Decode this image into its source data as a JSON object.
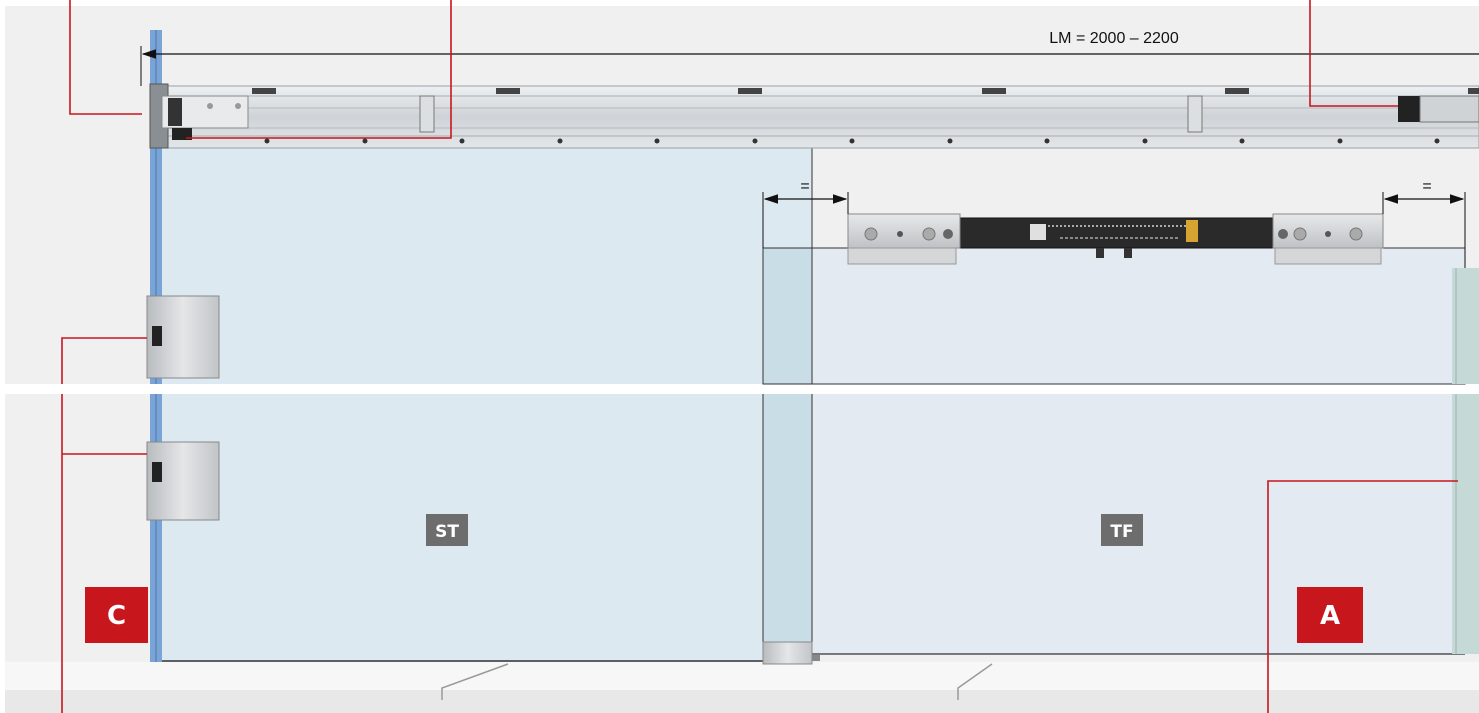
{
  "dimension": {
    "lm_label": "LM = 2000 – 2200",
    "equal_left": "=",
    "equal_right": "="
  },
  "panels": {
    "fixed_label": "ST",
    "sliding_label": "TF"
  },
  "callouts": {
    "left_label": "C",
    "right_label": "A"
  },
  "colors": {
    "accent_red": "#c8161d",
    "glass": "#dde9f1",
    "blue_edge": "#7aa3d6",
    "rail": "#d9dcdf",
    "label_gray": "#6d6d6d"
  }
}
